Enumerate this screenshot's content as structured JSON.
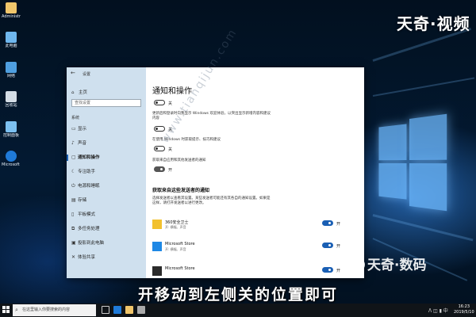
{
  "brand_top": "天奇·视频",
  "brand_bottom": "天奇·数码",
  "caption": "开移动到左侧关的位置即可",
  "watermark": "www.tianqijun.com",
  "desktop_icons": [
    {
      "label": "Administrator"
    },
    {
      "label": "此电脑"
    },
    {
      "label": "网络"
    },
    {
      "label": "回收站"
    },
    {
      "label": "控制面板"
    },
    {
      "label": "Microsoft Edge"
    }
  ],
  "settings": {
    "window_title": "设置",
    "home_label": "主页",
    "search_placeholder": "查找设置",
    "section_label": "系统",
    "nav": [
      {
        "icon": "display-icon",
        "label": "显示"
      },
      {
        "icon": "sound-icon",
        "label": "声音"
      },
      {
        "icon": "notification-icon",
        "label": "通知和操作",
        "active": true
      },
      {
        "icon": "focus-icon",
        "label": "专注助手"
      },
      {
        "icon": "power-icon",
        "label": "电源和睡眠"
      },
      {
        "icon": "storage-icon",
        "label": "存储"
      },
      {
        "icon": "tablet-icon",
        "label": "平板模式"
      },
      {
        "icon": "multitask-icon",
        "label": "多任务处理"
      },
      {
        "icon": "project-icon",
        "label": "投影到此电脑"
      },
      {
        "icon": "shared-icon",
        "label": "体验共享"
      }
    ],
    "content_title": "通知和操作",
    "toggles": [
      {
        "state": "关",
        "style": "off",
        "desc": ""
      },
      {
        "state": "关",
        "style": "off",
        "desc": "更新后和登录时向我显示 Windows 欢迎体验，以突出显示新增内容和建议内容"
      },
      {
        "state": "关",
        "style": "off",
        "desc": "在使用 Windows 时获取提示、技巧和建议"
      },
      {
        "state": "开",
        "style": "dark",
        "desc": "获取来自应用和其他发送者的通知"
      }
    ],
    "apps_heading": "获取来自这些发送者的通知",
    "apps_desc": "选择发送者以查看其设置。某些发送者可能还有其各自的通知设置。如果是这样，请打开发送者以进行更改。",
    "apps": [
      {
        "name": "360安全卫士",
        "sub": "开: 横幅、声音",
        "state": "开",
        "color": "#f2c12e"
      },
      {
        "name": "Microsoft Store",
        "sub": "开: 横幅、声音",
        "state": "开",
        "color": "#1e88e5"
      },
      {
        "name": "Microsoft Store",
        "sub": "",
        "state": "开",
        "color": "#2b2b2b"
      }
    ]
  },
  "taskbar": {
    "search_placeholder": "在这里输入你要搜索的内容",
    "time": "16:23",
    "date": "2019/5/10"
  }
}
